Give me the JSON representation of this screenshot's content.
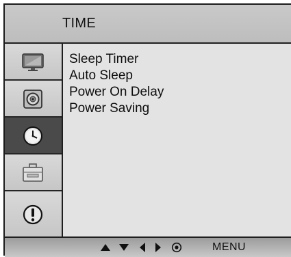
{
  "header": {
    "title": "TIME"
  },
  "sidebar": {
    "items": [
      {
        "icon": "picture-icon",
        "active": false
      },
      {
        "icon": "audio-icon",
        "active": false
      },
      {
        "icon": "clock-icon",
        "active": true
      },
      {
        "icon": "toolbox-icon",
        "active": false
      },
      {
        "icon": "info-icon",
        "active": false
      }
    ]
  },
  "menu": {
    "items": [
      {
        "label": "Sleep Timer"
      },
      {
        "label": "Auto Sleep"
      },
      {
        "label": "Power On Delay"
      },
      {
        "label": "Power Saving"
      }
    ]
  },
  "footer": {
    "nav_icons": [
      "up-arrow-icon",
      "down-arrow-icon",
      "left-arrow-icon",
      "right-arrow-icon",
      "ok-icon"
    ],
    "menu_label": "MENU"
  },
  "colors": {
    "header_bg": "#c4c4c4",
    "sidebar_bg": "#d0d0d0",
    "active_item_bg": "#4a4a4a",
    "content_bg": "#e3e3e3",
    "border": "#1f1f1f"
  }
}
